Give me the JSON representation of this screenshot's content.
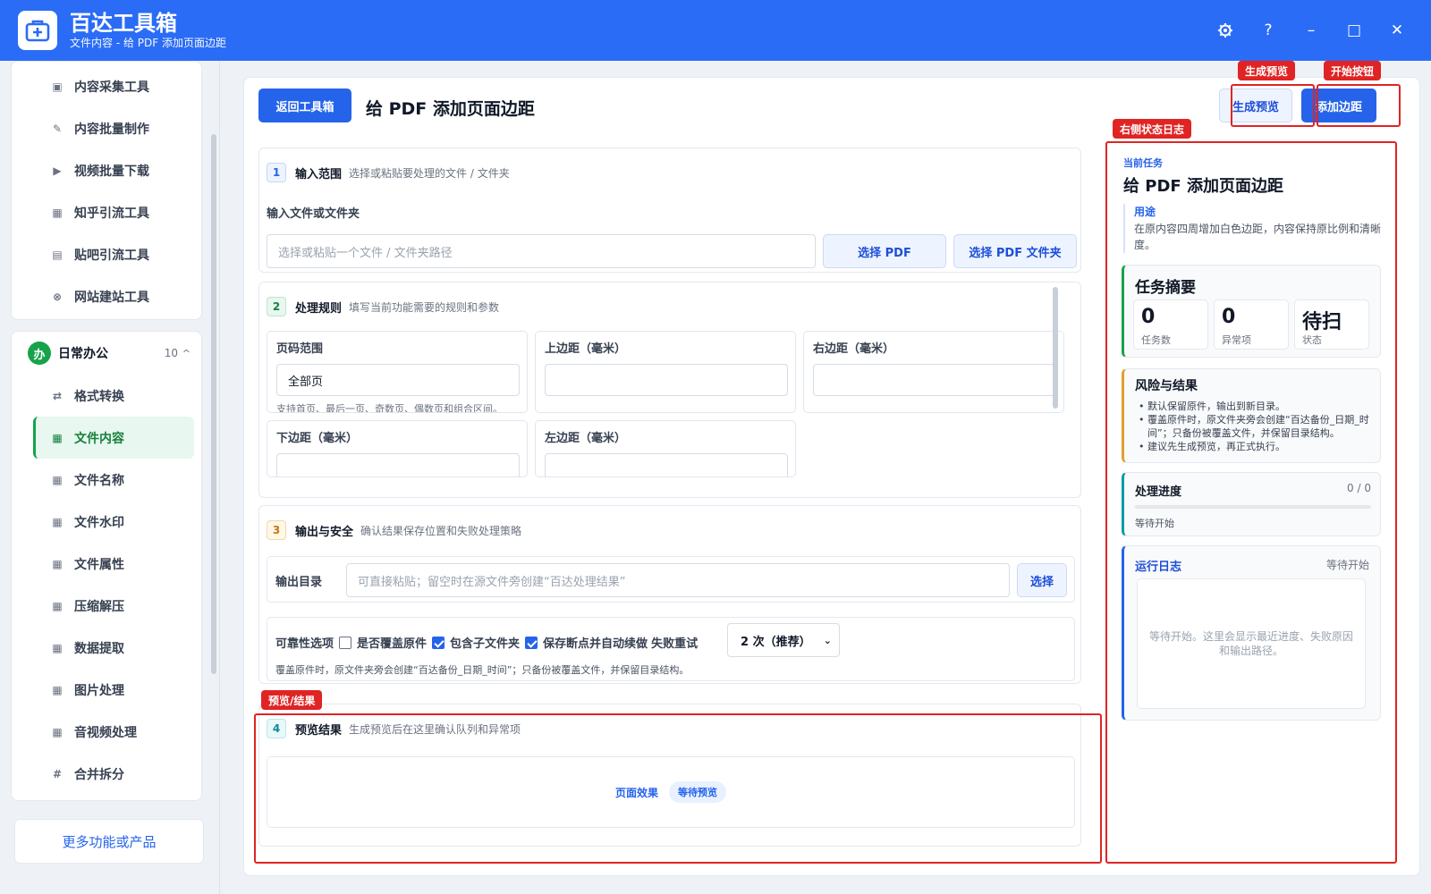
{
  "app": {
    "title": "百达工具箱",
    "subtitle": "文件内容 - 给 PDF 添加页面边距"
  },
  "window_controls": {
    "settings_icon": "gear-icon",
    "help_label": "?",
    "minimize_label": "–",
    "maximize_label": "□",
    "close_label": "✕"
  },
  "sidebar": {
    "top_items": [
      {
        "label": "内容采集工具",
        "icon": "▣"
      },
      {
        "label": "内容批量制作",
        "icon": "✎"
      },
      {
        "label": "视频批量下载",
        "icon": "▶"
      },
      {
        "label": "知乎引流工具",
        "icon": "▦"
      },
      {
        "label": "贴吧引流工具",
        "icon": "▤"
      },
      {
        "label": "网站建站工具",
        "icon": "⊗"
      }
    ],
    "group": {
      "badge": "办",
      "title": "日常办公",
      "count": "10",
      "caret": "^"
    },
    "group_items": [
      {
        "label": "格式转换",
        "icon": "⇄"
      },
      {
        "label": "文件内容",
        "icon": "▦"
      },
      {
        "label": "文件名称",
        "icon": "▦"
      },
      {
        "label": "文件水印",
        "icon": "▦"
      },
      {
        "label": "文件属性",
        "icon": "▦"
      },
      {
        "label": "压缩解压",
        "icon": "▦"
      },
      {
        "label": "数据提取",
        "icon": "▦"
      },
      {
        "label": "图片处理",
        "icon": "▦"
      },
      {
        "label": "音视频处理",
        "icon": "▦"
      },
      {
        "label": "合并拆分",
        "icon": "#"
      }
    ],
    "active_item": "文件内容",
    "more_label": "更多功能或产品"
  },
  "header": {
    "back_label": "返回工具箱",
    "page_title": "给 PDF 添加页面边距",
    "preview_label": "生成预览",
    "start_label": "添加边距"
  },
  "section1": {
    "num": "1",
    "title": "输入范围",
    "desc": "选择或粘贴要处理的文件 / 文件夹",
    "field_label": "输入文件或文件夹",
    "input_placeholder": "选择或粘贴一个文件 / 文件夹路径",
    "btn_pdf": "选择 PDF",
    "btn_folder": "选择 PDF 文件夹"
  },
  "section2": {
    "num": "2",
    "title": "处理规则",
    "desc": "填写当前功能需要的规则和参数",
    "params": [
      {
        "label": "页码范围",
        "value": "全部页",
        "hint": "支持首页、最后一页、奇数页、偶数页和组合区间。"
      },
      {
        "label": "上边距（毫米）",
        "value": "",
        "hint": ""
      },
      {
        "label": "右边距（毫米）",
        "value": "",
        "hint": ""
      },
      {
        "label": "下边距（毫米）",
        "value": "",
        "hint": ""
      },
      {
        "label": "左边距（毫米）",
        "value": "",
        "hint": ""
      }
    ]
  },
  "section3": {
    "num": "3",
    "title": "输出与安全",
    "desc": "确认结果保存位置和失败处理策略",
    "output_label": "输出目录",
    "output_placeholder": "可直接粘贴；留空时在源文件旁创建“百达处理结果”",
    "choose_label": "选择",
    "reliability_label": "可靠性选项",
    "opt_overwrite": "是否覆盖原件",
    "opt_subfolder": "包含子文件夹",
    "opt_resume": "保存断点并自动续做",
    "retry_label": "失败重试",
    "retry_value": "2 次（推荐）",
    "options_checked": {
      "overwrite": false,
      "subfolder": true,
      "resume": true
    },
    "note": "覆盖原件时，原文件夹旁会创建“百达备份_日期_时间”；只备份被覆盖文件，并保留目录结构。"
  },
  "section4": {
    "num": "4",
    "title": "预览结果",
    "desc": "生成预览后在这里确认队列和异常项",
    "effect_label": "页面效果",
    "status_pill": "等待预览"
  },
  "annotations": {
    "preview_tag": "生成预览",
    "start_tag": "开始按钮",
    "log_tag": "右侧状态日志",
    "result_tag": "预览/结果"
  },
  "right_panel": {
    "current_label": "当前任务",
    "task_title": "给 PDF 添加页面边距",
    "use_label": "用途",
    "use_text": "在原内容四周增加白色边距，内容保持原比例和清晰度。",
    "summary_title": "任务摘要",
    "stats": [
      {
        "value": "0",
        "label": "任务数"
      },
      {
        "value": "0",
        "label": "异常项"
      },
      {
        "value": "待扫",
        "label": "状态"
      }
    ],
    "risk_title": "风险与结果",
    "risks": [
      "默认保留原件，输出到新目录。",
      "覆盖原件时，原文件夹旁会创建“百达备份_日期_时间”；只备份被覆盖文件，并保留目录结构。",
      "建议先生成预览，再正式执行。"
    ],
    "progress_title": "处理进度",
    "progress_count": "0 / 0",
    "progress_fraction": 0,
    "progress_status": "等待开始",
    "log_title": "运行日志",
    "log_status": "等待开始",
    "log_placeholder": "等待开始。这里会显示最近进度、失败原因和输出路径。"
  },
  "colors": {
    "accent": "#2563eb",
    "titlebar": "#2a6cf6",
    "active_green": "#16a34a",
    "annotation_red": "#e02424"
  }
}
